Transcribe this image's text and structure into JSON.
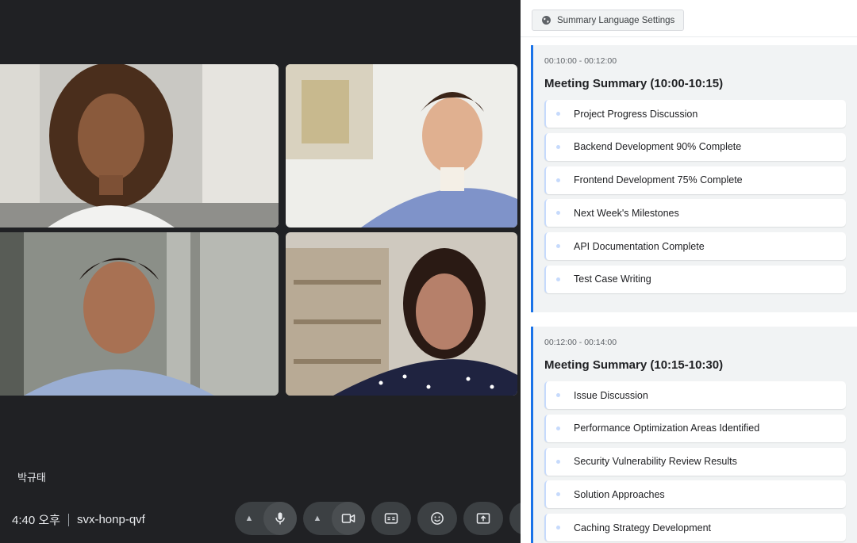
{
  "meeting": {
    "self_name": "박규태",
    "time": "4:40 오후",
    "code": "svx-honp-qvf"
  },
  "controls": {
    "mic": "mic-icon",
    "camera": "camera-icon",
    "captions": "captions-icon",
    "reactions": "emoji-icon",
    "present": "present-icon"
  },
  "summary_panel": {
    "settings_label": "Summary Language Settings",
    "sections": [
      {
        "time_range": "00:10:00 - 00:12:00",
        "title": "Meeting Summary (10:00-10:15)",
        "items": [
          "Project Progress Discussion",
          "Backend Development 90% Complete",
          "Frontend Development 75% Complete",
          "Next Week's Milestones",
          "API Documentation Complete",
          "Test Case Writing"
        ]
      },
      {
        "time_range": "00:12:00 - 00:14:00",
        "title": "Meeting Summary (10:15-10:30)",
        "items": [
          "Issue Discussion",
          "Performance Optimization Areas Identified",
          "Security Vulnerability Review Results",
          "Solution Approaches",
          "Caching Strategy Development"
        ]
      }
    ]
  },
  "colors": {
    "accent": "#1a73e8",
    "stage_bg": "#202124",
    "control_bg": "#3c4043"
  }
}
